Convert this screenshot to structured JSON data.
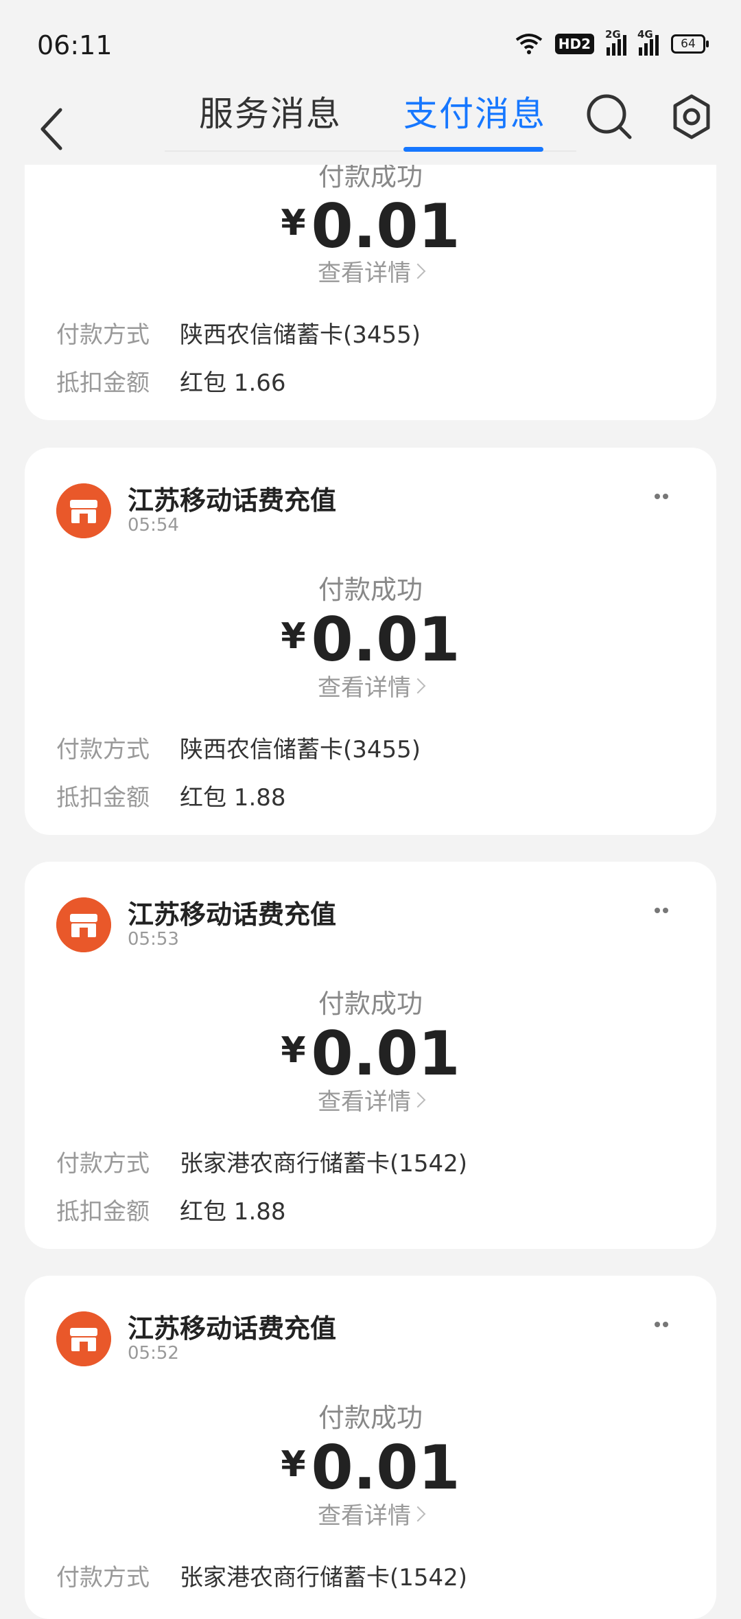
{
  "status_bar": {
    "time": "06:11",
    "hd_label": "HD2",
    "signal_1_label": "2G",
    "signal_2_label": "4G",
    "battery": "64"
  },
  "header": {
    "tabs": [
      {
        "label": "服务消息",
        "active": false
      },
      {
        "label": "支付消息",
        "active": true
      }
    ],
    "accent_color": "#1677ff"
  },
  "labels": {
    "status": "付款成功",
    "currency": "¥",
    "view_details": "查看详情",
    "payment_method": "付款方式",
    "deduction": "抵扣金额"
  },
  "messages": [
    {
      "merchant": "",
      "time": "",
      "amount": "0.01",
      "payment_method": "陕西农信储蓄卡(3455)",
      "deduction": "红包 1.66"
    },
    {
      "merchant": "江苏移动话费充值",
      "time": "05:54",
      "amount": "0.01",
      "payment_method": "陕西农信储蓄卡(3455)",
      "deduction": "红包 1.88"
    },
    {
      "merchant": "江苏移动话费充值",
      "time": "05:53",
      "amount": "0.01",
      "payment_method": "张家港农商行储蓄卡(1542)",
      "deduction": "红包 1.88"
    },
    {
      "merchant": "江苏移动话费充值",
      "time": "05:52",
      "amount": "0.01",
      "payment_method": "张家港农商行储蓄卡(1542)",
      "deduction": ""
    }
  ]
}
